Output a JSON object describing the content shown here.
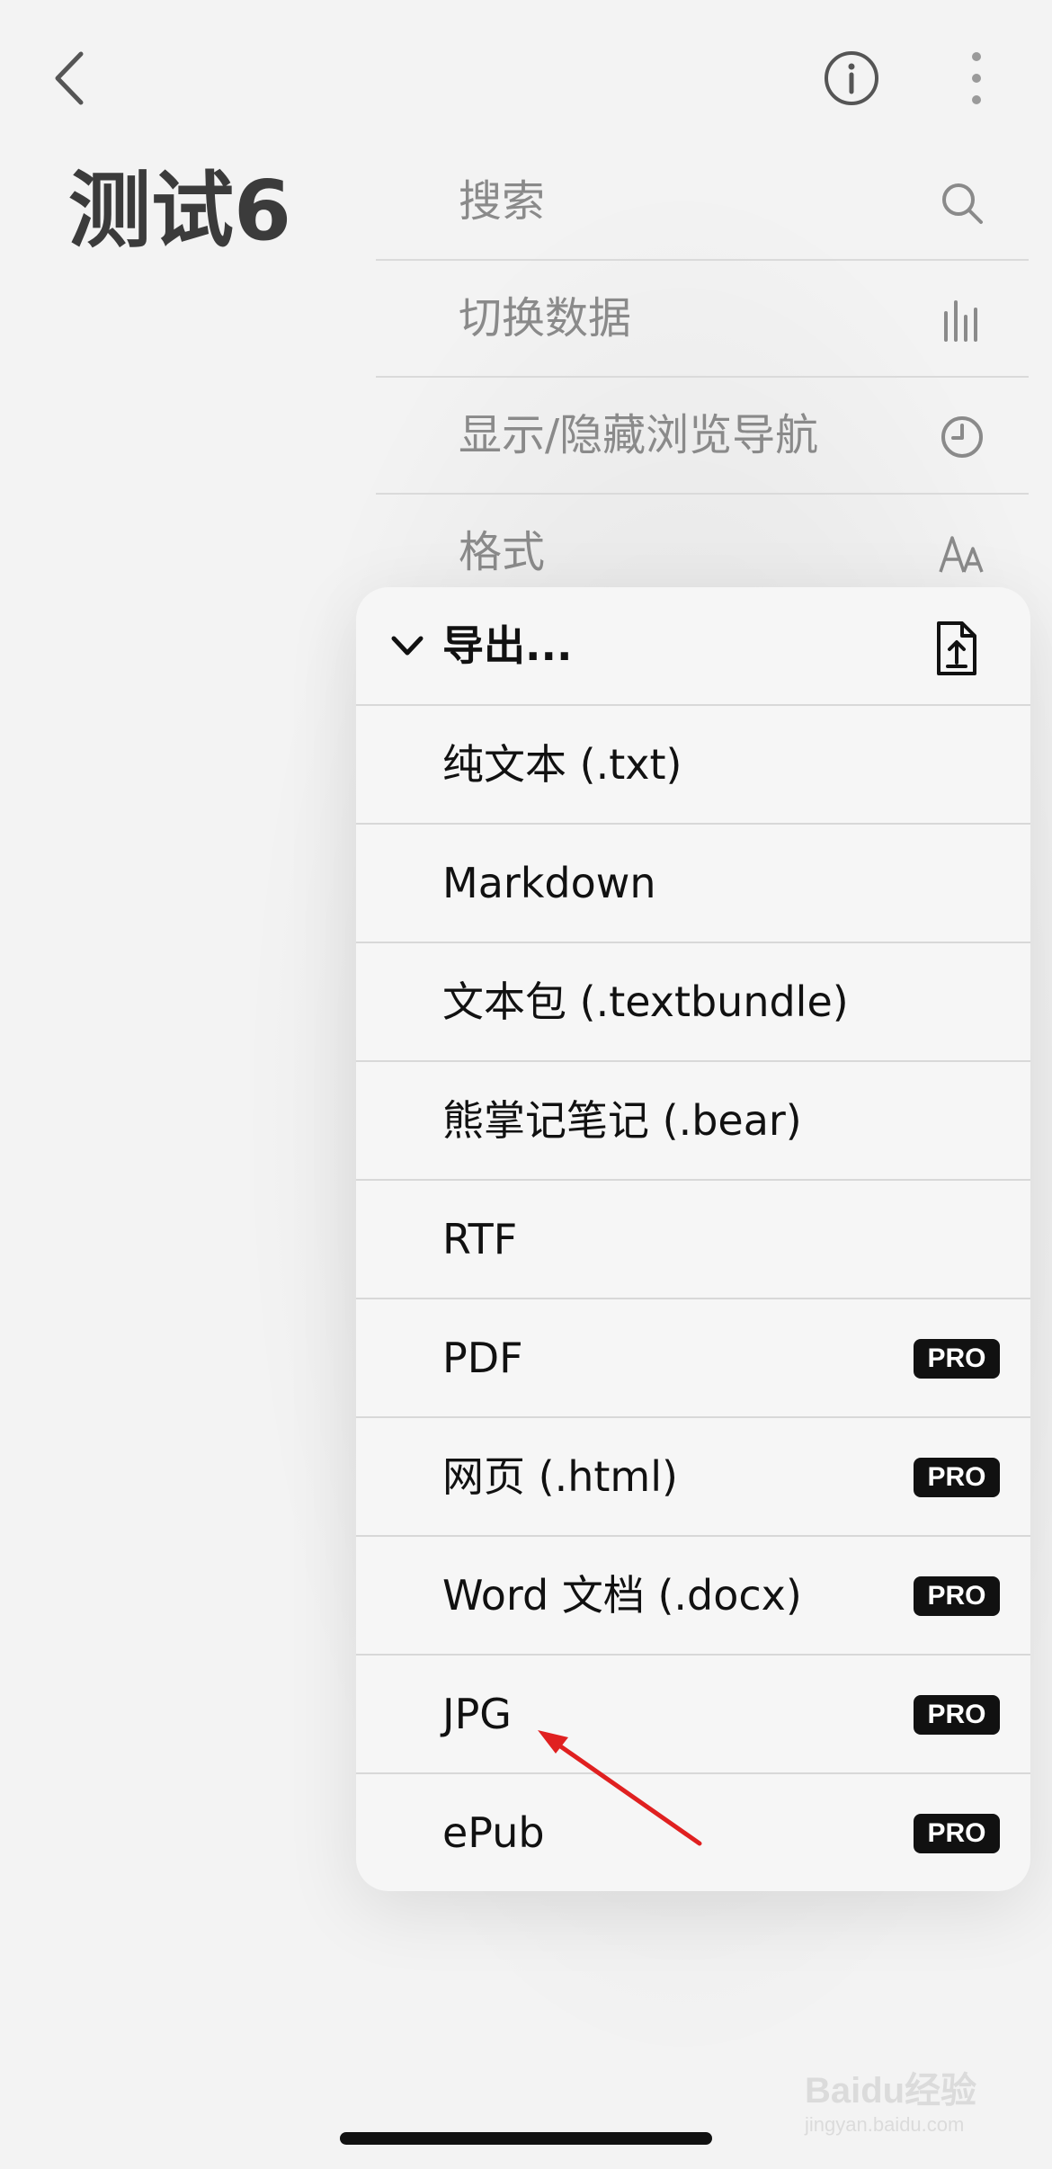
{
  "header": {
    "back_icon": "chevron-left-icon",
    "info_icon": "info-circle-icon",
    "more_icon": "more-vertical-icon",
    "title": "测试6"
  },
  "menu": {
    "items": [
      {
        "label": "搜索",
        "icon": "search-icon"
      },
      {
        "label": "切换数据",
        "icon": "stats-bars-icon"
      },
      {
        "label": "显示/隐藏浏览导航",
        "icon": "clock-icon"
      },
      {
        "label": "格式",
        "icon": "text-format-icon"
      }
    ]
  },
  "export": {
    "title": "导出...",
    "chevron_icon": "chevron-down-icon",
    "share_icon": "file-export-icon",
    "items": [
      {
        "label": "纯文本 (.txt)",
        "pro": ""
      },
      {
        "label": "Markdown",
        "pro": ""
      },
      {
        "label": "文本包 (.textbundle)",
        "pro": ""
      },
      {
        "label": "熊掌记笔记 (.bear)",
        "pro": ""
      },
      {
        "label": "RTF",
        "pro": ""
      },
      {
        "label": "PDF",
        "pro": "PRO"
      },
      {
        "label": "网页 (.html)",
        "pro": "PRO"
      },
      {
        "label": "Word 文档 (.docx)",
        "pro": "PRO"
      },
      {
        "label": "JPG",
        "pro": "PRO"
      },
      {
        "label": "ePub",
        "pro": "PRO"
      }
    ]
  },
  "watermark": {
    "brand": "Baidu经验",
    "url": "jingyan.baidu.com"
  },
  "colors": {
    "accent_dark": "#111111",
    "dimmed_text": "#8a8a8a",
    "annotation_arrow": "#e02020"
  }
}
